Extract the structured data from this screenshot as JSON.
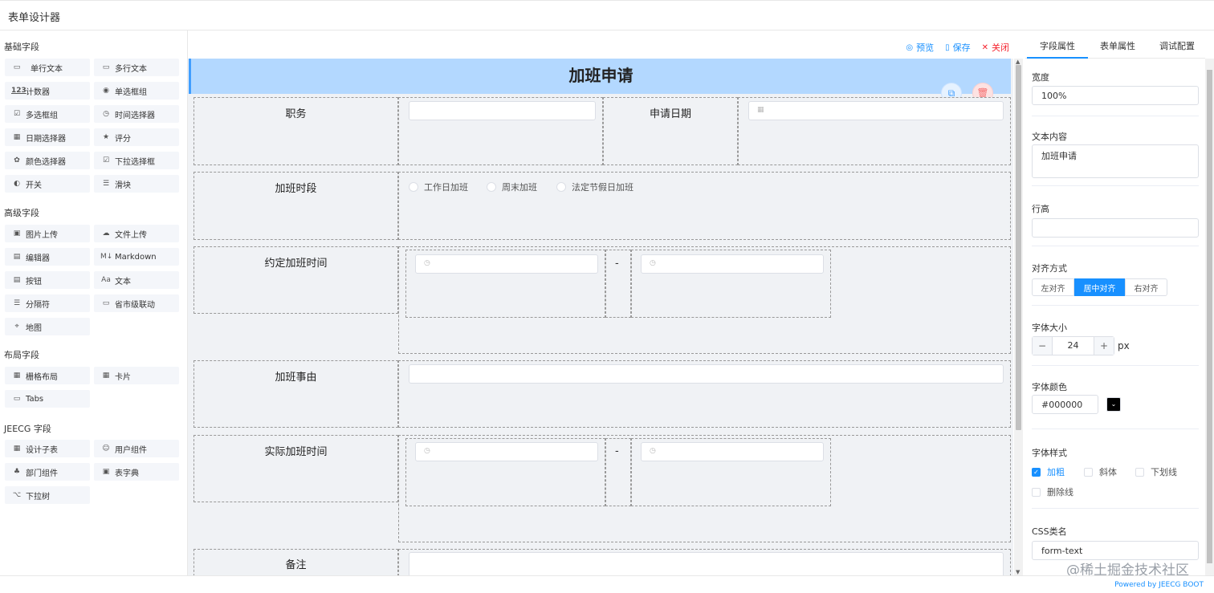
{
  "app": {
    "title": "表单设计器",
    "footer": "Powered by JEECG BOOT",
    "watermark": "@稀土掘金技术社区"
  },
  "palette": {
    "groups": [
      {
        "title": "基础字段",
        "items": [
          {
            "label": "单行文本",
            "icon": "▭"
          },
          {
            "label": "多行文本",
            "icon": "▭"
          },
          {
            "label": "计数器",
            "icon": "123"
          },
          {
            "label": "单选框组",
            "icon": "◉"
          },
          {
            "label": "多选框组",
            "icon": "☑"
          },
          {
            "label": "时间选择器",
            "icon": "◷"
          },
          {
            "label": "日期选择器",
            "icon": "▦"
          },
          {
            "label": "评分",
            "icon": "★"
          },
          {
            "label": "颜色选择器",
            "icon": "✿"
          },
          {
            "label": "下拉选择框",
            "icon": "☑"
          },
          {
            "label": "开关",
            "icon": "◐"
          },
          {
            "label": "滑块",
            "icon": "☰"
          }
        ]
      },
      {
        "title": "高级字段",
        "items": [
          {
            "label": "图片上传",
            "icon": "▣"
          },
          {
            "label": "文件上传",
            "icon": "☁"
          },
          {
            "label": "编辑器",
            "icon": "▤"
          },
          {
            "label": "Markdown",
            "icon": "M↓"
          },
          {
            "label": "按钮",
            "icon": "▤"
          },
          {
            "label": "文本",
            "icon": "Aa"
          },
          {
            "label": "分隔符",
            "icon": "☰"
          },
          {
            "label": "省市级联动",
            "icon": "▭"
          },
          {
            "label": "地图",
            "icon": "⌖"
          }
        ]
      },
      {
        "title": "布局字段",
        "items": [
          {
            "label": "栅格布局",
            "icon": "▦"
          },
          {
            "label": "卡片",
            "icon": "▦"
          },
          {
            "label": "Tabs",
            "icon": "▭"
          }
        ]
      },
      {
        "title": "JEECG 字段",
        "items": [
          {
            "label": "设计子表",
            "icon": "▦"
          },
          {
            "label": "用户组件",
            "icon": "☺"
          },
          {
            "label": "部门组件",
            "icon": "♣"
          },
          {
            "label": "表字典",
            "icon": "▣"
          },
          {
            "label": "下拉树",
            "icon": "⌥"
          }
        ]
      }
    ]
  },
  "toolbar": {
    "preview": "预览",
    "save": "保存",
    "close": "关闭"
  },
  "form": {
    "heading": "加班申请",
    "rows": {
      "duty": "职务",
      "apply_date": "申请日期",
      "period": "加班时段",
      "period_options": [
        "工作日加班",
        "周末加班",
        "法定节假日加班"
      ],
      "agreed_time": "约定加班时间",
      "reason": "加班事由",
      "actual_time": "实际加班时间",
      "remark": "备注",
      "range_separator": "-"
    }
  },
  "props": {
    "tabs": [
      "字段属性",
      "表单属性",
      "调试配置"
    ],
    "width_label": "宽度",
    "width_value": "100%",
    "text_label": "文本内容",
    "text_value": "加班申请",
    "line_height_label": "行高",
    "line_height_value": "",
    "align_label": "对齐方式",
    "align_options": [
      "左对齐",
      "居中对齐",
      "右对齐"
    ],
    "align_selected": "居中对齐",
    "font_size_label": "字体大小",
    "font_size_value": "24",
    "font_size_unit": "px",
    "font_color_label": "字体颜色",
    "font_color_value": "#000000",
    "font_style_label": "字体样式",
    "font_styles": [
      {
        "label": "加粗",
        "checked": true
      },
      {
        "label": "斜体",
        "checked": false
      },
      {
        "label": "下划线",
        "checked": false
      },
      {
        "label": "删除线",
        "checked": false
      }
    ],
    "css_label": "CSS类名",
    "css_value": "form-text"
  },
  "colors": {
    "accent": "#1890ff",
    "header_bg": "#b3d8ff",
    "danger": "#f5222d"
  }
}
